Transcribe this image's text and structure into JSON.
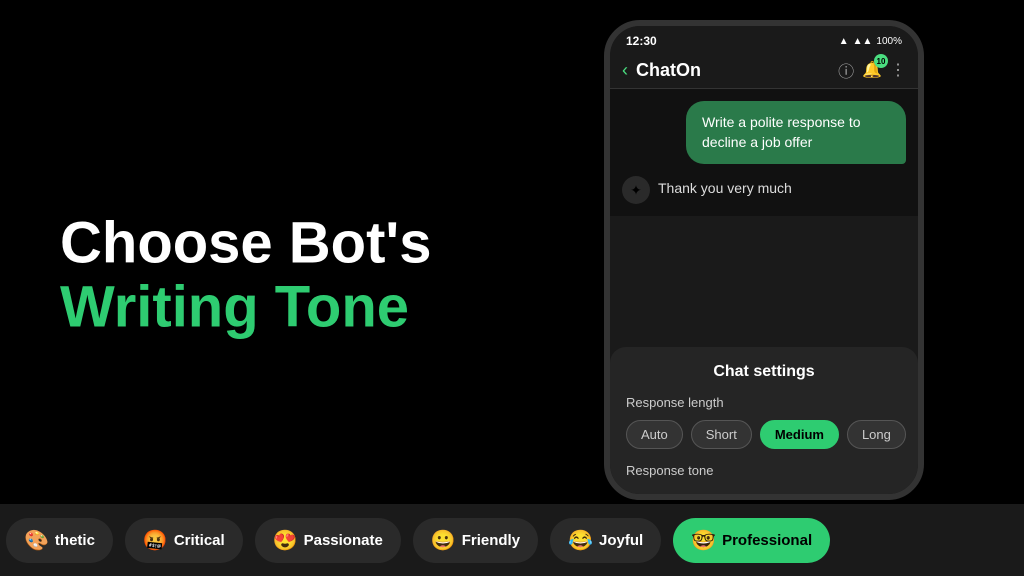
{
  "background": "#000000",
  "left": {
    "line1": "Choose Bot's",
    "line2": "Writing Tone"
  },
  "phone": {
    "statusBar": {
      "time": "12:30",
      "battery": "100%"
    },
    "header": {
      "title": "ChatOn",
      "badgeCount": "10"
    },
    "chat": {
      "userMessage": "Write a polite response to decline a job offer",
      "botMessage": "Thank you very much"
    },
    "settings": {
      "title": "Chat settings",
      "responseLengthLabel": "Response length",
      "buttons": [
        "Auto",
        "Short",
        "Medium",
        "Long"
      ],
      "activeButton": "Medium",
      "responseToneLabel": "Response tone"
    }
  },
  "toneBar": {
    "items": [
      {
        "emoji": "🎨",
        "label": "thetic",
        "active": false
      },
      {
        "emoji": "🤬",
        "label": "Critical",
        "active": false
      },
      {
        "emoji": "😍",
        "label": "Passionate",
        "active": false
      },
      {
        "emoji": "😀",
        "label": "Friendly",
        "active": false
      },
      {
        "emoji": "😂",
        "label": "Joyful",
        "active": false
      },
      {
        "emoji": "🤓",
        "label": "Professional",
        "active": true
      }
    ]
  }
}
